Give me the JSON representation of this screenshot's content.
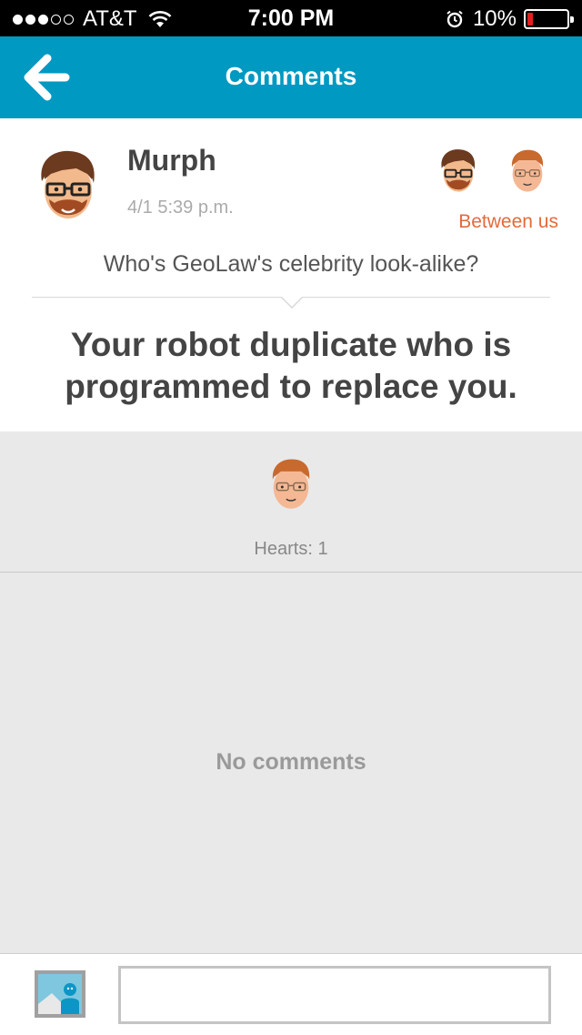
{
  "status_bar": {
    "carrier": "AT&T",
    "time": "7:00 PM",
    "battery": "10%"
  },
  "navbar": {
    "title": "Comments",
    "back_icon": "back-arrow-icon"
  },
  "post": {
    "author": "Murph",
    "date": "4/1 5:39 p.m.",
    "visibility": "Between us",
    "question": "Who's GeoLaw's celebrity look-alike?",
    "answer_line1": "Your robot duplicate who is",
    "answer_line2": "programmed to replace you."
  },
  "hearts": {
    "label": "Hearts: 1"
  },
  "comments": {
    "empty_text": "No comments"
  },
  "composer": {
    "image_icon": "image-icon",
    "placeholder": ""
  },
  "colors": {
    "accent": "#0099c2",
    "visibility": "#e46a3a",
    "background": "#e9e9e9"
  }
}
